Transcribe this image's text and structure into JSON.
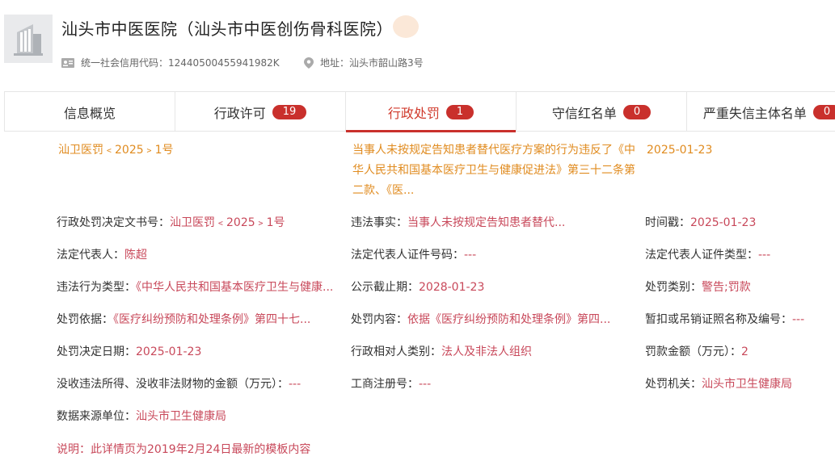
{
  "company": {
    "name": "汕头市中医医院（汕头市中医创伤骨科医院）",
    "credit_label": "统一社会信用代码：",
    "credit_code": "12440500455941982K",
    "address_label": "地址：",
    "address": "汕头市韶山路3号"
  },
  "tabs": [
    {
      "label": "信息概览",
      "count": null
    },
    {
      "label": "行政许可",
      "count": "19"
    },
    {
      "label": "行政处罚",
      "count": "1"
    },
    {
      "label": "守信红名单",
      "count": "0"
    },
    {
      "label": "严重失信主体名单",
      "count": "0"
    }
  ],
  "summary": {
    "code": "汕卫医罚﹤2025﹥1号",
    "description": "当事人未按规定告知患者替代医疗方案的行为违反了《中华人民共和国基本医疗卫生与健康促进法》第三十二条第二款、《医...",
    "date": "2025-01-23"
  },
  "fields": {
    "decision_no": {
      "label": "行政处罚决定文书号：",
      "value": "汕卫医罚﹤2025﹥1号"
    },
    "illegal_fact": {
      "label": "违法事实：",
      "value": "当事人未按规定告知患者替代..."
    },
    "timestamp": {
      "label": "时间戳：",
      "value": "2025-01-23"
    },
    "legal_rep": {
      "label": "法定代表人：",
      "value": "陈超"
    },
    "legal_rep_id_no": {
      "label": "法定代表人证件号码：",
      "value": "---"
    },
    "legal_rep_id_type": {
      "label": "法定代表人证件类型：",
      "value": "---"
    },
    "violation_type": {
      "label": "违法行为类型：",
      "value": "《中华人民共和国基本医疗卫生与健康..."
    },
    "publish_deadline": {
      "label": "公示截止期：",
      "value": "2028-01-23"
    },
    "penalty_category": {
      "label": "处罚类别：",
      "value": "警告;罚款"
    },
    "penalty_basis": {
      "label": "处罚依据：",
      "value": "《医疗纠纷预防和处理条例》第四十七..."
    },
    "penalty_content": {
      "label": "处罚内容：",
      "value": "依据《医疗纠纷预防和处理条例》第四..."
    },
    "license_suspend": {
      "label": "暂扣或吊销证照名称及编号：",
      "value": "---"
    },
    "decision_date": {
      "label": "处罚决定日期：",
      "value": "2025-01-23"
    },
    "counterpart_type": {
      "label": "行政相对人类别：",
      "value": "法人及非法人组织"
    },
    "fine_amount": {
      "label": "罚款金额（万元）：",
      "value": "2"
    },
    "confiscated_amount": {
      "label": "没收违法所得、没收非法财物的金额（万元）：",
      "value": "---"
    },
    "business_reg_no": {
      "label": "工商注册号：",
      "value": "---"
    },
    "penalty_authority": {
      "label": "处罚机关：",
      "value": "汕头市卫生健康局"
    },
    "data_source": {
      "label": "数据来源单位：",
      "value": "汕头市卫生健康局"
    }
  },
  "note": "说明：此详情页为2019年2月24日最新的模板内容",
  "colors": {
    "accent": "#c9302c",
    "summary": "#e08b1f",
    "value": "#c8485a"
  }
}
